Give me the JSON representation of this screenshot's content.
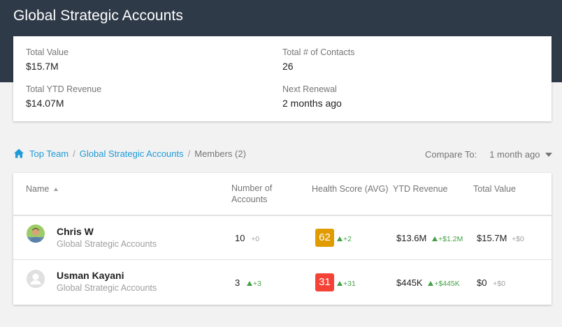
{
  "page": {
    "title": "Global Strategic Accounts"
  },
  "summary": {
    "total_value_label": "Total Value",
    "total_value": "$15.7M",
    "contacts_label": "Total # of Contacts",
    "contacts": "26",
    "ytd_label": "Total YTD Revenue",
    "ytd": "$14.07M",
    "renewal_label": "Next Renewal",
    "renewal": "2 months ago"
  },
  "breadcrumb": {
    "top": "Top Team",
    "mid": "Global Strategic Accounts",
    "current": "Members (2)"
  },
  "compare": {
    "label": "Compare To:",
    "value": "1 month ago"
  },
  "table": {
    "headers": {
      "name": "Name",
      "accounts_1": "Number of",
      "accounts_2": "Accounts",
      "health": "Health Score (AVG)",
      "ytd": "YTD Revenue",
      "total": "Total Value"
    },
    "rows": [
      {
        "name": "Chris W",
        "team": "Global Strategic Accounts",
        "accounts": "10",
        "accounts_delta": "+0",
        "score": "62",
        "score_delta": "+2",
        "score_color": "#e09b00",
        "ytd": "$13.6M",
        "ytd_delta": "+$1.2M",
        "total": "$15.7M",
        "total_delta": "+$0"
      },
      {
        "name": "Usman Kayani",
        "team": "Global Strategic Accounts",
        "accounts": "3",
        "accounts_delta": "+3",
        "score": "31",
        "score_delta": "+31",
        "score_color": "#f44336",
        "ytd": "$445K",
        "ytd_delta": "+$445K",
        "total": "$0",
        "total_delta": "+$0"
      }
    ]
  },
  "colors": {
    "header_bg": "#2f3a49",
    "link": "#1e9ad6",
    "positive": "#43a047"
  }
}
